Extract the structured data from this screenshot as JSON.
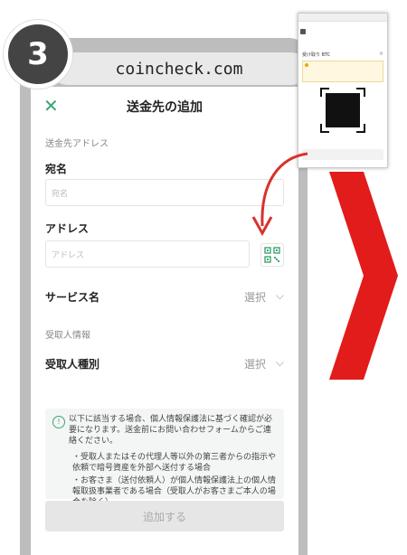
{
  "step": "3",
  "browser": {
    "url": "coincheck.com"
  },
  "header": {
    "close_icon": "close-icon",
    "title": "送金先の追加"
  },
  "form": {
    "section_address": "送金先アドレス",
    "name_label": "宛名",
    "name_placeholder": "宛名",
    "address_label": "アドレス",
    "address_placeholder": "アドレス",
    "qr_icon": "qr-scan-icon",
    "service_label": "サービス名",
    "service_value": "選択",
    "section_recipient": "受取人情報",
    "recipient_type_label": "受取人種別",
    "recipient_type_value": "選択"
  },
  "notice": {
    "icon": "info-icon",
    "main": "以下に該当する場合、個人情報保護法に基づく確認が必要になります。送金前にお問い合わせフォームからご連絡ください。",
    "bullet1": "・受取人またはその代理人等以外の第三者からの指示や依頼で暗号資産を外部へ送付する場合",
    "bullet2": "・お客さま（送付依頼人）が個人情報保護法上の個人情報取扱事業者である場合（受取人がお客さまご本人の場合を除く）"
  },
  "add_button": "追加する",
  "modal": {
    "title": "受け取り BTC",
    "accent_color": "#e21b1b"
  }
}
